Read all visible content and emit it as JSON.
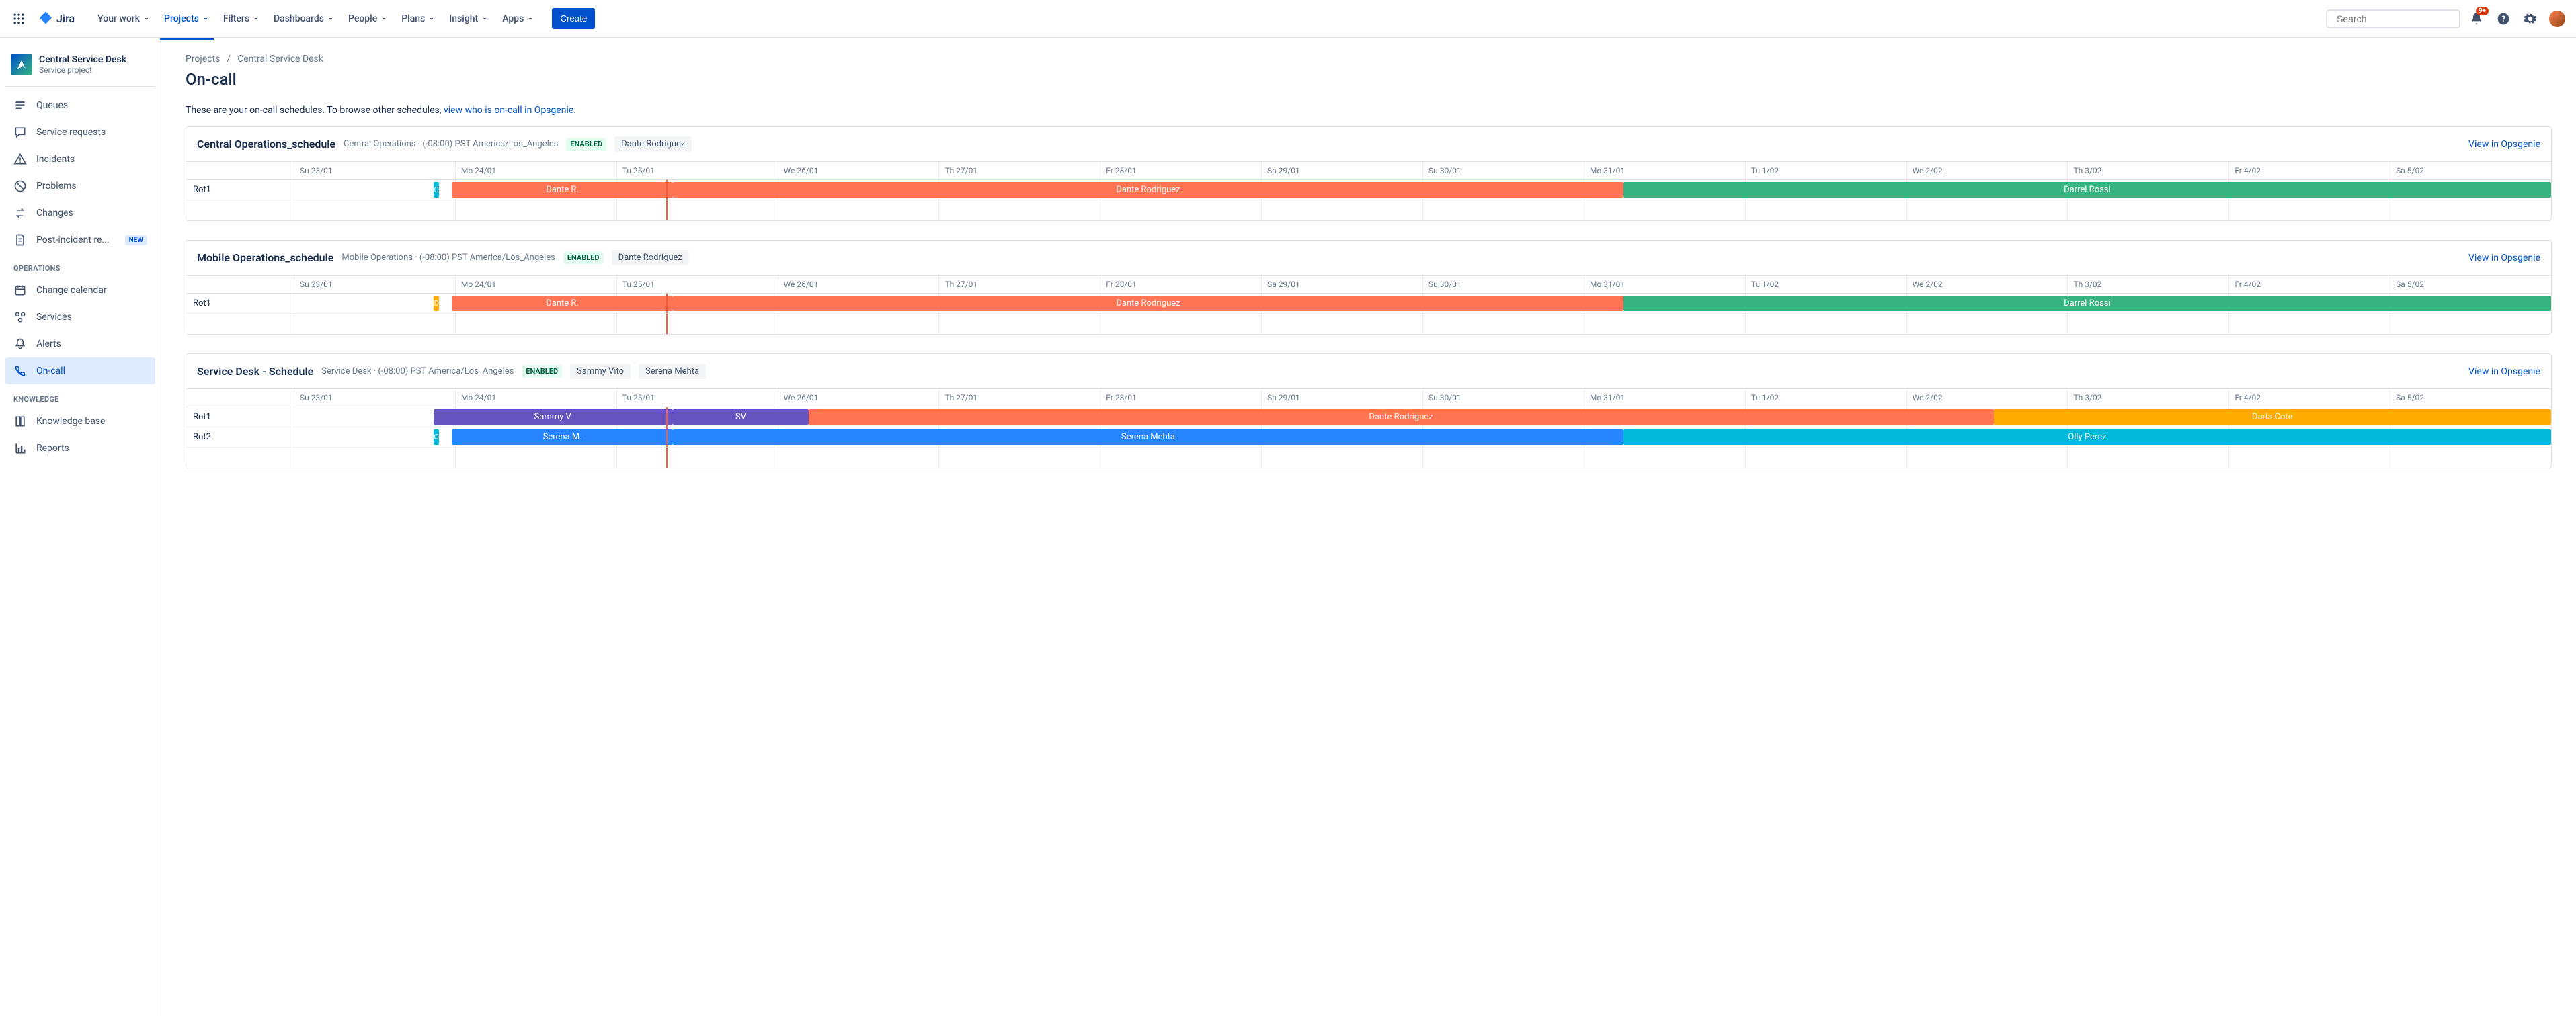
{
  "topnav": {
    "product": "Jira",
    "items": [
      "Your work",
      "Projects",
      "Filters",
      "Dashboards",
      "People",
      "Plans",
      "Insight",
      "Apps"
    ],
    "active_index": 1,
    "create_label": "Create",
    "search_placeholder": "Search",
    "notification_badge": "9+"
  },
  "sidebar": {
    "project_name": "Central Service Desk",
    "project_sub": "Service project",
    "items": [
      {
        "label": "Queues",
        "icon": "queues-icon"
      },
      {
        "label": "Service requests",
        "icon": "chat-icon"
      },
      {
        "label": "Incidents",
        "icon": "warning-icon"
      },
      {
        "label": "Problems",
        "icon": "no-entry-icon"
      },
      {
        "label": "Changes",
        "icon": "swap-icon"
      },
      {
        "label": "Post-incident re...",
        "icon": "document-icon",
        "lozenge": "NEW"
      }
    ],
    "section_operations": "OPERATIONS",
    "ops_items": [
      {
        "label": "Change calendar",
        "icon": "calendar-icon"
      },
      {
        "label": "Services",
        "icon": "services-icon"
      },
      {
        "label": "Alerts",
        "icon": "bell-icon"
      },
      {
        "label": "On-call",
        "icon": "phone-icon",
        "active": true
      }
    ],
    "section_knowledge": "KNOWLEDGE",
    "kn_items": [
      {
        "label": "Knowledge base",
        "icon": "book-icon"
      },
      {
        "label": "Reports",
        "icon": "chart-icon"
      }
    ]
  },
  "breadcrumb": {
    "root": "Projects",
    "current": "Central Service Desk"
  },
  "page_title": "On-call",
  "intro_text": "These are your on-call schedules. To browse other schedules, ",
  "intro_link": "view who is on-call in Opsgenie",
  "view_link_label": "View in Opsgenie",
  "days": [
    "Su 23/01",
    "Mo 24/01",
    "Tu 25/01",
    "We 26/01",
    "Th 27/01",
    "Fr 28/01",
    "Sa 29/01",
    "Su 30/01",
    "Mo 31/01",
    "Tu 1/02",
    "We 2/02",
    "Th 3/02",
    "Fr 4/02",
    "Sa 5/02"
  ],
  "now_position_pct": 16.5,
  "schedules": [
    {
      "name": "Central Operations_schedule",
      "meta": "Central Operations · (-08:00) PST America/Los_Angeles",
      "status": "ENABLED",
      "people": [
        "Dante Rodriguez"
      ],
      "rows": [
        {
          "label": "Rot1",
          "ticks": [
            {
              "left_pct": 6.2,
              "color": "#00b8d9",
              "text": "C"
            }
          ],
          "bars": [
            {
              "left_pct": 7.0,
              "width_pct": 9.8,
              "color": "#ff7452",
              "text": "Dante R."
            },
            {
              "left_pct": 16.8,
              "width_pct": 42.1,
              "color": "#ff7452",
              "text": "Dante Rodriguez"
            },
            {
              "left_pct": 58.9,
              "width_pct": 41.1,
              "color": "#36b37e",
              "text": "Darrel Rossi"
            }
          ]
        }
      ]
    },
    {
      "name": "Mobile Operations_schedule",
      "meta": "Mobile Operations · (-08:00) PST America/Los_Angeles",
      "status": "ENABLED",
      "people": [
        "Dante Rodriguez"
      ],
      "rows": [
        {
          "label": "Rot1",
          "ticks": [
            {
              "left_pct": 6.2,
              "color": "#ffab00",
              "text": "D"
            }
          ],
          "bars": [
            {
              "left_pct": 7.0,
              "width_pct": 9.8,
              "color": "#ff7452",
              "text": "Dante R."
            },
            {
              "left_pct": 16.8,
              "width_pct": 42.1,
              "color": "#ff7452",
              "text": "Dante Rodriguez"
            },
            {
              "left_pct": 58.9,
              "width_pct": 41.1,
              "color": "#36b37e",
              "text": "Darrel Rossi"
            }
          ]
        }
      ]
    },
    {
      "name": "Service Desk - Schedule",
      "meta": "Service Desk · (-08:00) PST America/Los_Angeles",
      "status": "ENABLED",
      "people": [
        "Sammy Vito",
        "Serena Mehta"
      ],
      "rows": [
        {
          "label": "Rot1",
          "ticks": [],
          "bars": [
            {
              "left_pct": 6.2,
              "width_pct": 10.6,
              "color": "#6554c0",
              "text": "Sammy V."
            },
            {
              "left_pct": 16.8,
              "width_pct": 6.0,
              "color": "#6554c0",
              "text": "SV"
            },
            {
              "left_pct": 22.8,
              "width_pct": 52.5,
              "color": "#ff7452",
              "text": "Dante Rodriguez"
            },
            {
              "left_pct": 75.3,
              "width_pct": 24.7,
              "color": "#ffab00",
              "text": "Darla Cote"
            }
          ]
        },
        {
          "label": "Rot2",
          "ticks": [
            {
              "left_pct": 6.2,
              "color": "#00b8d9",
              "text": "O"
            }
          ],
          "bars": [
            {
              "left_pct": 7.0,
              "width_pct": 9.8,
              "color": "#2684ff",
              "text": "Serena M."
            },
            {
              "left_pct": 16.8,
              "width_pct": 42.1,
              "color": "#2684ff",
              "text": "Serena Mehta"
            },
            {
              "left_pct": 58.9,
              "width_pct": 41.1,
              "color": "#00b8d9",
              "text": "Olly Perez"
            }
          ]
        }
      ]
    }
  ]
}
